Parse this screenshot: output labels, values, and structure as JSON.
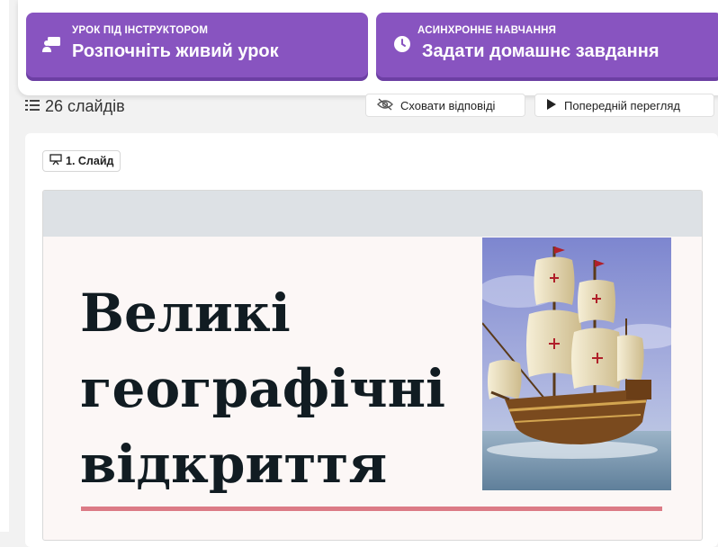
{
  "actions": {
    "live": {
      "small": "УРОК ПІД ІНСТРУКТОРОМ",
      "big": "Розпочніть живий урок",
      "icon": "presentation-icon"
    },
    "homework": {
      "small": "АСИНХРОННЕ НАВЧАННЯ",
      "big": "Задати домашнє завдання",
      "icon": "clock-icon"
    }
  },
  "toolbar": {
    "slides_count": "26 слайдів",
    "hide_answers": "Сховати відповіді",
    "preview": "Попередній перегляд"
  },
  "slide": {
    "tag": "1. Слайд",
    "title_lines": [
      "Великі",
      "географічні",
      "відкриття"
    ],
    "image": "sailing-ship",
    "accent_color": "#dc7b86"
  },
  "colors": {
    "brand": "#8854c0",
    "brand_shadow": "#6c3fa3"
  }
}
